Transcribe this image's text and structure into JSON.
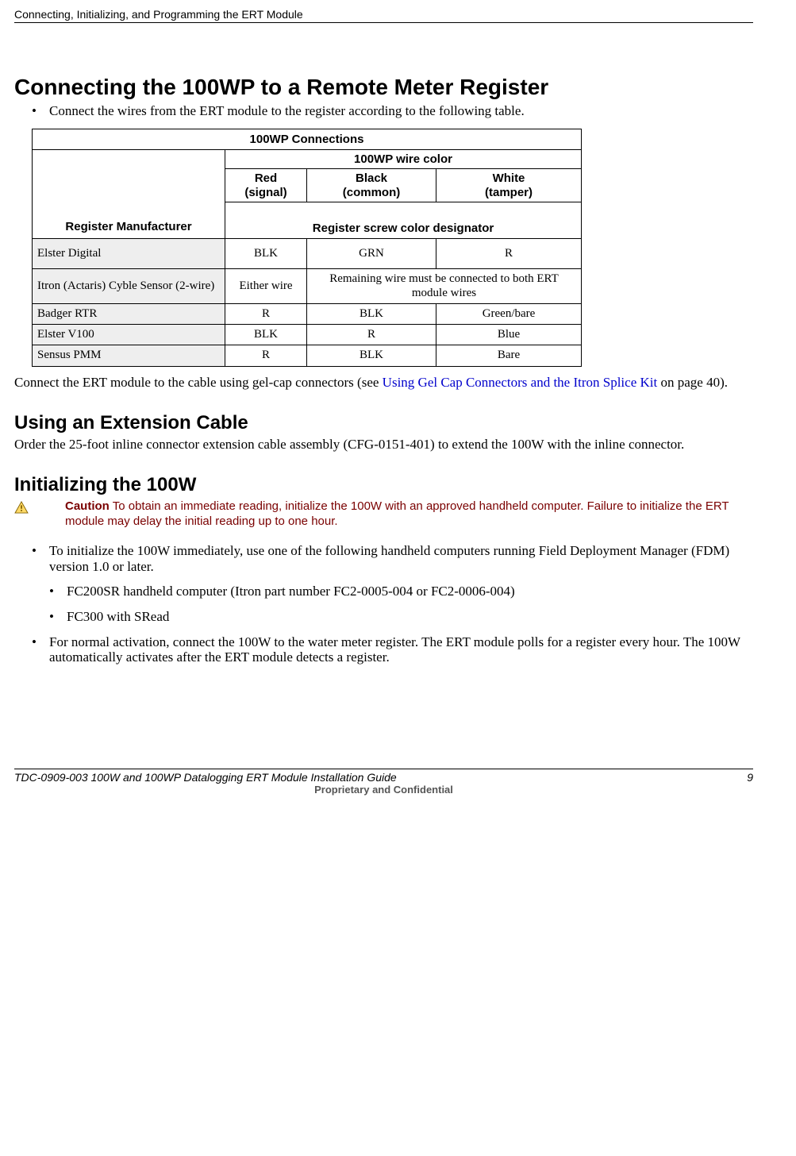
{
  "header": {
    "running_head": "Connecting, Initializing, and Programming the ERT Module"
  },
  "sec1": {
    "title": "Connecting the 100WP to a Remote Meter Register",
    "bullet": "Connect the wires from the ERT module to the register according to the following table.",
    "after_table_1": "Connect the ERT module to the cable using gel-cap connectors (see ",
    "after_table_link": "Using Gel Cap Connectors and the Itron Splice Kit",
    "after_table_2": " on page 40)."
  },
  "table": {
    "title": "100WP Connections",
    "wire_color_header": "100WP wire color",
    "cols": {
      "red_1": "Red",
      "red_2": "(signal)",
      "black_1": "Black",
      "black_2": "(common)",
      "white_1": "White",
      "white_2": "(tamper)"
    },
    "reg_mfg": "Register Manufacturer",
    "reg_screw": "Register screw color designator",
    "rows": [
      {
        "mfg": "Elster Digital",
        "red": "BLK",
        "black": "GRN",
        "white": "R"
      },
      {
        "mfg": "Itron (Actaris) Cyble Sensor (2-wire)",
        "red": "Either wire",
        "merged": "Remaining wire must be connected to both ERT module wires"
      },
      {
        "mfg": "Badger RTR",
        "red": "R",
        "black": "BLK",
        "white": "Green/bare"
      },
      {
        "mfg": "Elster V100",
        "red": "BLK",
        "black": "R",
        "white": "Blue"
      },
      {
        "mfg": "Sensus PMM",
        "red": "R",
        "black": "BLK",
        "white": "Bare"
      }
    ]
  },
  "sec2": {
    "title": "Using an Extension Cable",
    "body": "Order the 25-foot inline connector extension cable assembly (CFG-0151-401) to extend the 100W with the inline connector."
  },
  "sec3": {
    "title": "Initializing the 100W",
    "caution_label": "Caution",
    "caution_body": "  To obtain an immediate reading, initialize the 100W with an approved handheld computer. Failure to initialize the ERT module may delay the initial reading up to one hour.",
    "bullets": [
      "To initialize the 100W immediately, use one of the following handheld computers running Field Deployment Manager (FDM) version 1.0 or later.",
      "FC200SR handheld computer (Itron part number FC2-0005-004 or FC2-0006-004)",
      "FC300 with SRead",
      "For normal activation, connect the 100W to the water meter register. The ERT module polls for a register every hour. The 100W automatically activates after the ERT module detects a register."
    ]
  },
  "footer": {
    "left": "TDC-0909-003 100W and 100WP Datalogging ERT Module Installation Guide",
    "right": "9",
    "center": "Proprietary and Confidential"
  }
}
